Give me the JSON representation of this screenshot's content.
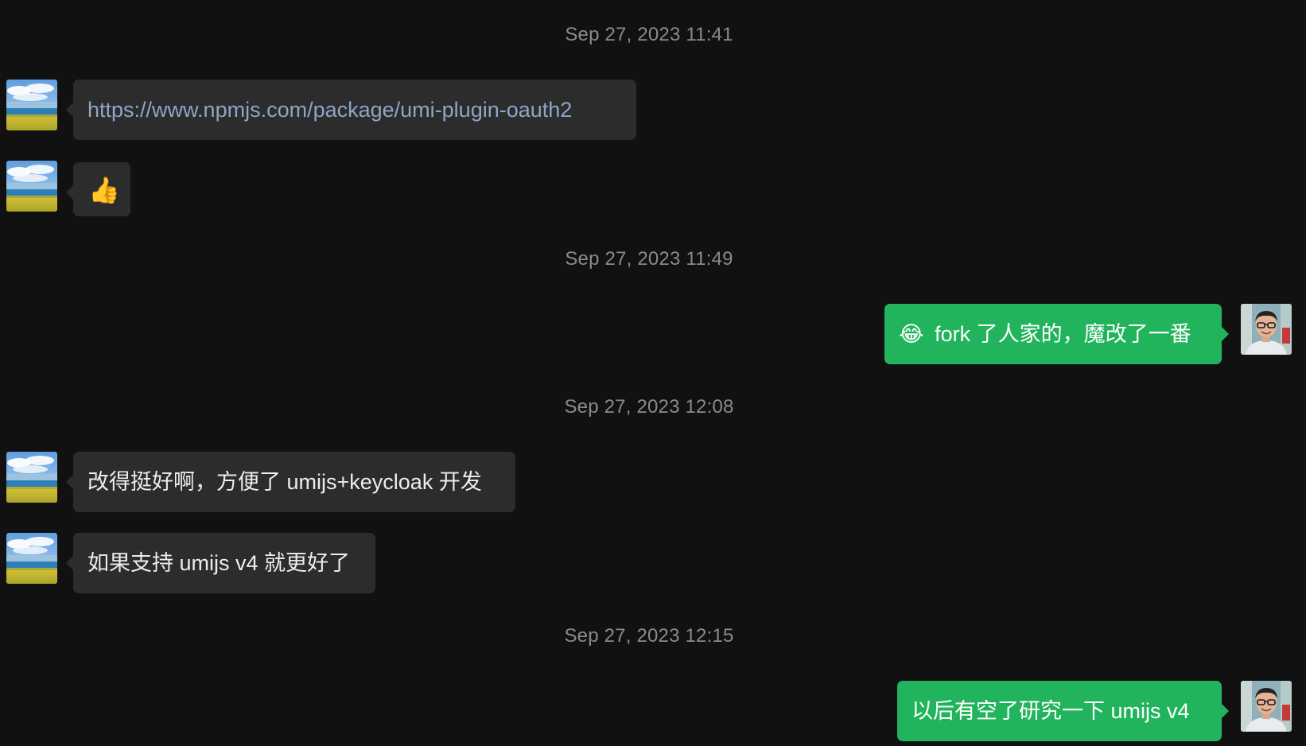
{
  "timestamps": [
    "Sep 27, 2023 11:41",
    "Sep 27, 2023 11:49",
    "Sep 27, 2023 12:08",
    "Sep 27, 2023 12:15"
  ],
  "messages": [
    {
      "sender": "contact",
      "text": "https://www.npmjs.com/package/umi-plugin-oauth2"
    },
    {
      "sender": "contact",
      "text": "👍"
    },
    {
      "sender": "me",
      "emoji": "😂",
      "text": "fork 了人家的，魔改了一番"
    },
    {
      "sender": "contact",
      "text": "改得挺好啊，方便了 umijs+keycloak 开发"
    },
    {
      "sender": "contact",
      "text": "如果支持 umijs v4 就更好了"
    },
    {
      "sender": "me",
      "text": "以后有空了研究一下 umijs v4"
    }
  ],
  "colors": {
    "background": "#111111",
    "incoming_bubble": "#2c2c2c",
    "outgoing_bubble": "#21b45c",
    "link": "#8da6c6",
    "timestamp": "#8a8a8a"
  }
}
